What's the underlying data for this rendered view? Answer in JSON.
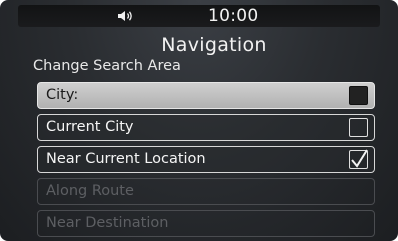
{
  "status": {
    "speaker_icon": "speaker-volume-icon",
    "time": "10:00"
  },
  "header": {
    "title": "Navigation",
    "subtitle": "Change Search Area"
  },
  "menu": {
    "items": [
      {
        "label": "City:",
        "state": "selected",
        "checkbox": "filled"
      },
      {
        "label": "Current City",
        "state": "normal",
        "checkbox": "empty"
      },
      {
        "label": "Near Current Location",
        "state": "normal",
        "checkbox": "checked"
      },
      {
        "label": "Along Route",
        "state": "disabled"
      },
      {
        "label": "Near Destination",
        "state": "disabled"
      }
    ]
  },
  "colors": {
    "background": "#2a2d31",
    "selected_item": "#c2c2c2",
    "item_border": "#d7d7d7",
    "disabled_text": "#5d5f63"
  }
}
